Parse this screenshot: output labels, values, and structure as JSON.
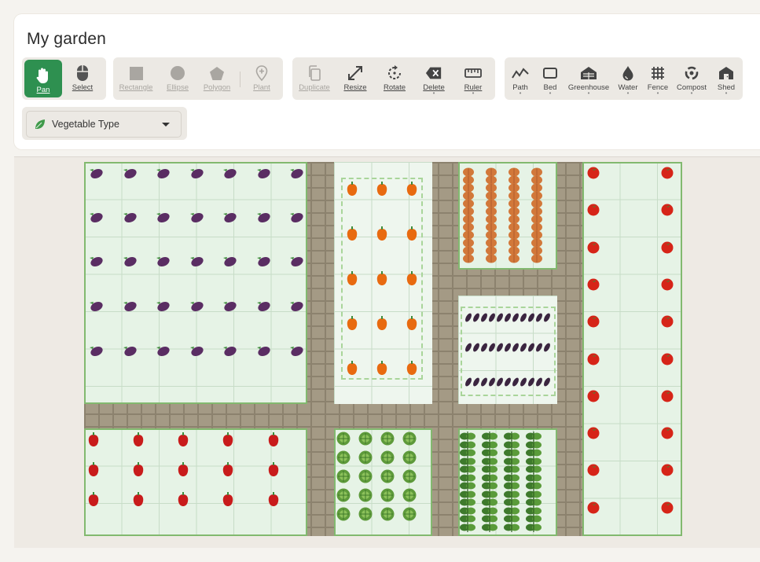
{
  "title": "My garden",
  "toolbar": {
    "pan_label": "Pan",
    "select_label": "Select",
    "rectangle_label": "Rectangle",
    "ellipse_label": "Ellipse",
    "polygon_label": "Polygon",
    "plant_label": "Plant",
    "duplicate_label": "Duplicate",
    "resize_label": "Resize",
    "rotate_label": "Rotate",
    "delete_label": "Delete",
    "ruler_label": "Ruler",
    "path_label": "Path",
    "bed_label": "Bed",
    "greenhouse_label": "Greenhouse",
    "water_label": "Water",
    "fence_label": "Fence",
    "compost_label": "Compost",
    "shed_label": "Shed"
  },
  "filter": {
    "label": "Vegetable Type"
  },
  "colors": {
    "accent": "#2e9050",
    "bed_fill": "#e6f3e6",
    "bed_border": "#82b96f",
    "path_stone": "#a49a85"
  },
  "beds": [
    {
      "name": "bed-eggplant",
      "plant": "eggplant"
    },
    {
      "name": "bed-orange-peppers",
      "plant": "orange-pepper"
    },
    {
      "name": "bed-onions",
      "plant": "onion"
    },
    {
      "name": "bed-eggplant-rows",
      "plant": "eggplant"
    },
    {
      "name": "bed-tomatoes",
      "plant": "tomato"
    },
    {
      "name": "bed-red-peppers",
      "plant": "red-pepper"
    },
    {
      "name": "bed-lettuce",
      "plant": "lettuce"
    },
    {
      "name": "bed-beans",
      "plant": "bean"
    }
  ]
}
